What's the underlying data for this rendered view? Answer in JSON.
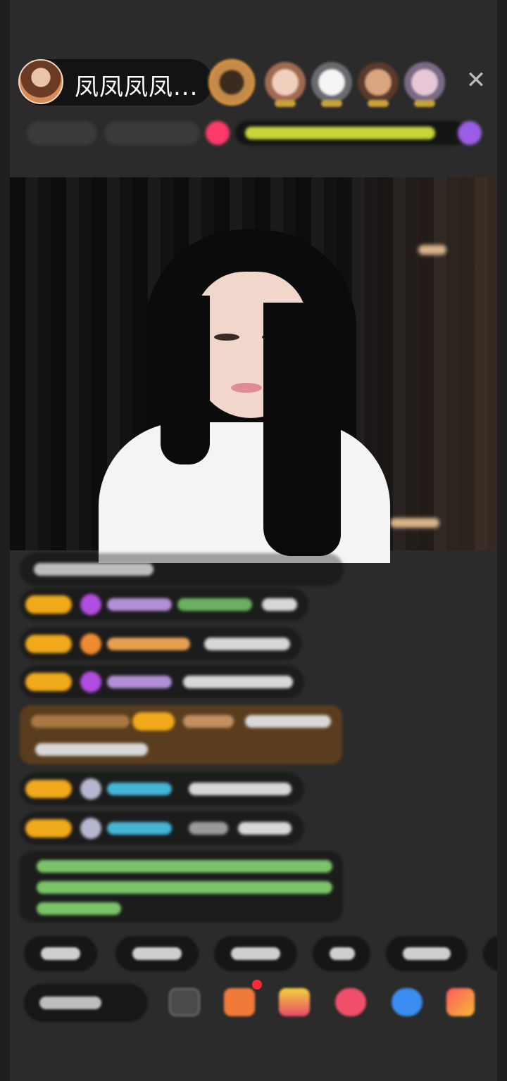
{
  "header": {
    "host_name": "凤凤凤凤...",
    "close_label": "✕",
    "viewers": [
      {
        "name": "viewer-avatar",
        "color": "#c58a4a"
      },
      {
        "name": "viewer-avatar",
        "color": "#d7a893"
      },
      {
        "name": "viewer-avatar",
        "color": "#bfbfc4"
      },
      {
        "name": "viewer-avatar",
        "color": "#a86a4c"
      },
      {
        "name": "viewer-avatar",
        "color": "#c7a8b8"
      }
    ]
  },
  "colors": {
    "frame_bg": "#2a2b2a",
    "level_badge": "#f0a91a",
    "announcement_text": "#7cc46a",
    "gift_highlight_bg": "#5a3d1e",
    "notification_dot": "#ff2a3a"
  },
  "icons": [
    "close-icon",
    "diamond-icon",
    "gift-box-icon",
    "heart-gift-icon",
    "shop-icon",
    "message-icon",
    "more-icon"
  ]
}
